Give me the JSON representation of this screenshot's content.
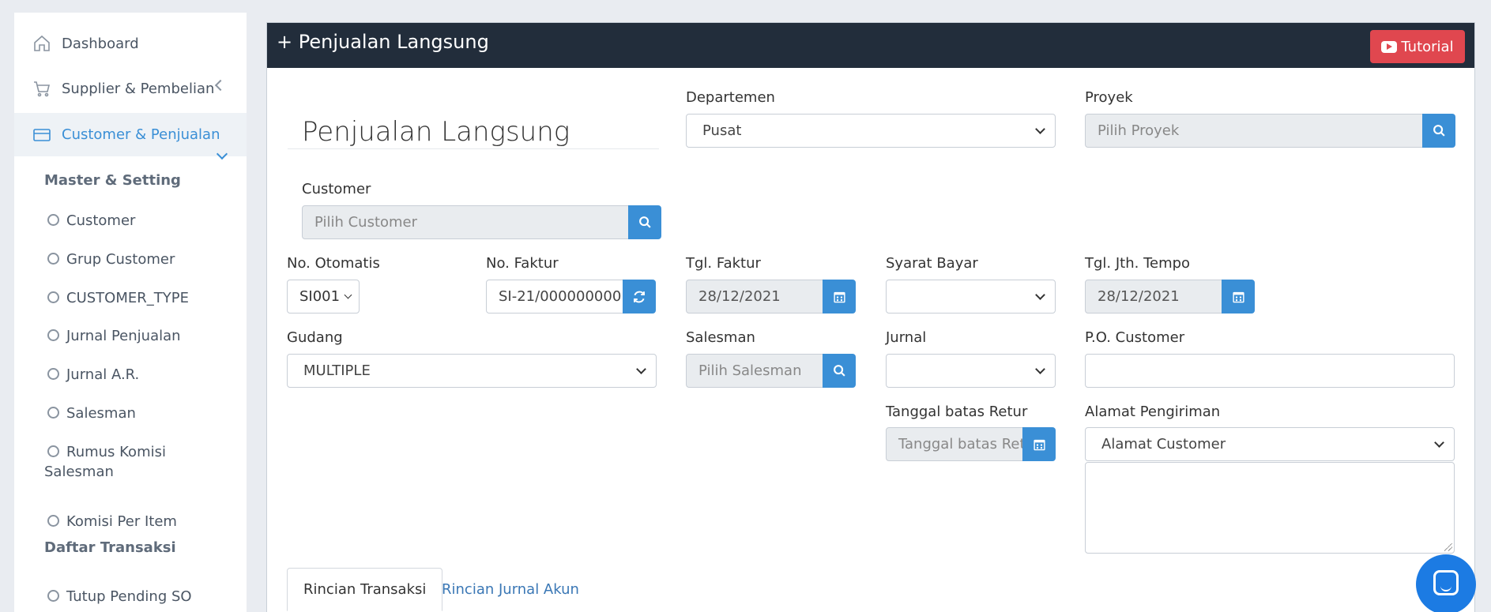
{
  "sidebar": {
    "items": [
      {
        "label": "Dashboard",
        "icon": "home-icon"
      },
      {
        "label": "Supplier & Pembelian",
        "icon": "cart-icon"
      },
      {
        "label": "Customer & Penjualan",
        "icon": "card-icon"
      }
    ],
    "section1": "Master & Setting",
    "section1_items": [
      "Customer",
      "Grup Customer",
      "CUSTOMER_TYPE",
      "Jurnal Penjualan",
      "Jurnal A.R.",
      "Salesman",
      "Rumus Komisi Salesman",
      "Komisi Per Item"
    ],
    "section2": "Daftar Transaksi",
    "section2_items": [
      "Tutup Pending SO"
    ]
  },
  "header": {
    "title": "+ Penjualan Langsung",
    "tutorial_label": "Tutorial"
  },
  "form": {
    "page_title": "Penjualan Langsung",
    "departemen": {
      "label": "Departemen",
      "value": "Pusat"
    },
    "proyek": {
      "label": "Proyek",
      "placeholder": "Pilih Proyek"
    },
    "customer": {
      "label": "Customer",
      "placeholder": "Pilih Customer"
    },
    "no_otomatis": {
      "label": "No. Otomatis",
      "value": "SI001"
    },
    "no_faktur": {
      "label": "No. Faktur",
      "value": "SI-21/000000000"
    },
    "tgl_faktur": {
      "label": "Tgl. Faktur",
      "value": "28/12/2021"
    },
    "syarat_bayar": {
      "label": "Syarat Bayar",
      "value": ""
    },
    "tgl_jth_tempo": {
      "label": "Tgl. Jth. Tempo",
      "value": "28/12/2021"
    },
    "gudang": {
      "label": "Gudang",
      "value": "MULTIPLE"
    },
    "salesman": {
      "label": "Salesman",
      "placeholder": "Pilih Salesman"
    },
    "jurnal": {
      "label": "Jurnal",
      "value": ""
    },
    "po_customer": {
      "label": "P.O. Customer",
      "value": ""
    },
    "tanggal_batas_retur": {
      "label": "Tanggal batas Retur",
      "placeholder": "Tanggal batas Retur"
    },
    "alamat_pengiriman": {
      "label": "Alamat Pengiriman",
      "value": "Alamat Customer"
    }
  },
  "tabs": [
    {
      "label": "Rincian Transaksi"
    },
    {
      "label": "Rincian Jurnal Akun"
    }
  ],
  "colors": {
    "accent": "#3a8fd6",
    "header": "#222d3b",
    "danger": "#e0474f"
  }
}
